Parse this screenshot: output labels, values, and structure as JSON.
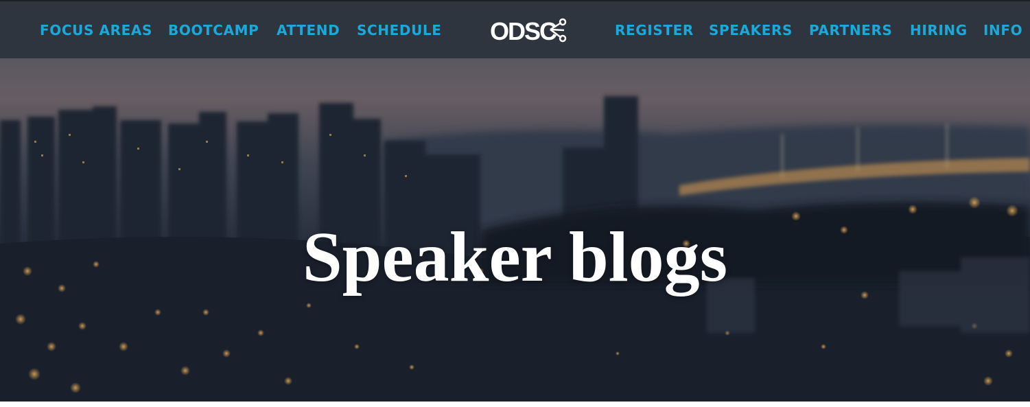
{
  "nav": {
    "left": [
      {
        "label": "FOCUS AREAS"
      },
      {
        "label": "BOOTCAMP"
      },
      {
        "label": "ATTEND"
      },
      {
        "label": "SCHEDULE"
      }
    ],
    "logo_text": "ODSC",
    "right": [
      {
        "label": "REGISTER"
      },
      {
        "label": "SPEAKERS"
      },
      {
        "label": "PARTNERS"
      },
      {
        "label": "HIRING"
      },
      {
        "label": "INFO"
      }
    ]
  },
  "hero": {
    "title": "Speaker blogs",
    "background_image": "blurred-city-skyline-night"
  },
  "colors": {
    "navbar_bg": "#2f353f",
    "nav_link": "#1aa9da",
    "title_text": "#ffffff"
  }
}
